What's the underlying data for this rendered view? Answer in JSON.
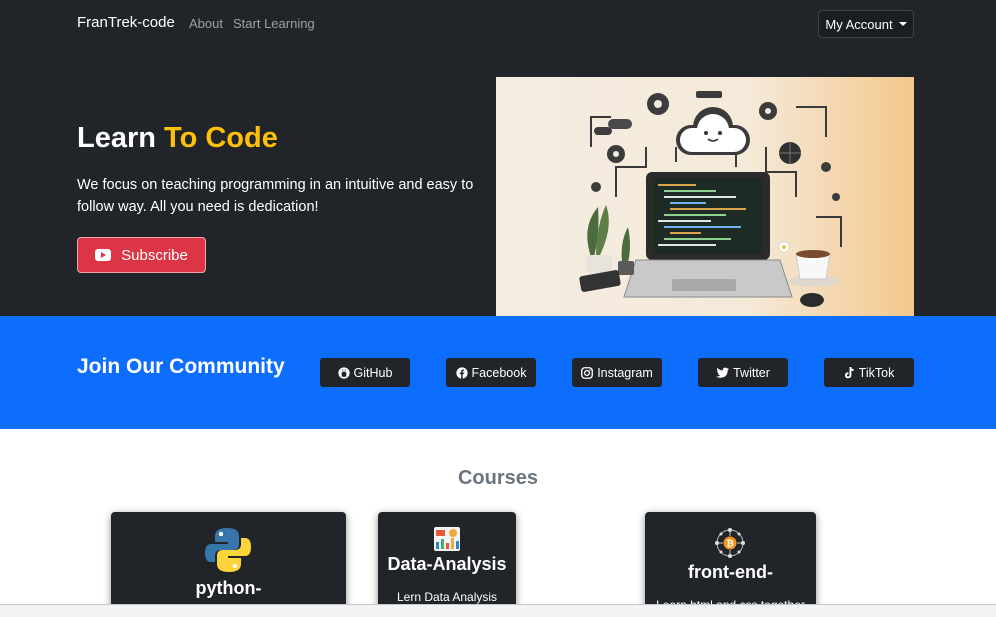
{
  "navbar": {
    "brand": "FranTrek-code",
    "links": [
      "About",
      "Start Learning"
    ],
    "account_label": "My Account"
  },
  "hero": {
    "title_part1": "Learn ",
    "title_part2": "To Code",
    "description": "We focus on teaching programming in an intuitive and easy to follow way. All you need is dedication!",
    "subscribe_label": "Subscribe"
  },
  "community": {
    "title": "Join Our Community",
    "links": [
      "GitHub",
      "Facebook",
      "Instagram",
      "Twitter",
      "TikTok"
    ]
  },
  "courses": {
    "title": "Courses",
    "items": [
      {
        "name": "python-",
        "description": ""
      },
      {
        "name": "Data-Analysis",
        "description": "Lern Data Analysis"
      },
      {
        "name": "front-end-",
        "description": "Learn html and css together"
      }
    ]
  },
  "colors": {
    "dark": "#212529",
    "accent_yellow": "#ffc107",
    "primary_blue": "#0d6efd",
    "danger_red": "#dc3545",
    "muted_gray": "#6c757d"
  },
  "icons": [
    "youtube-icon",
    "github-icon",
    "facebook-icon",
    "instagram-icon",
    "twitter-icon",
    "tiktok-icon",
    "python-logo-icon",
    "chart-icon",
    "bitcoin-network-icon",
    "caret-down-icon"
  ]
}
